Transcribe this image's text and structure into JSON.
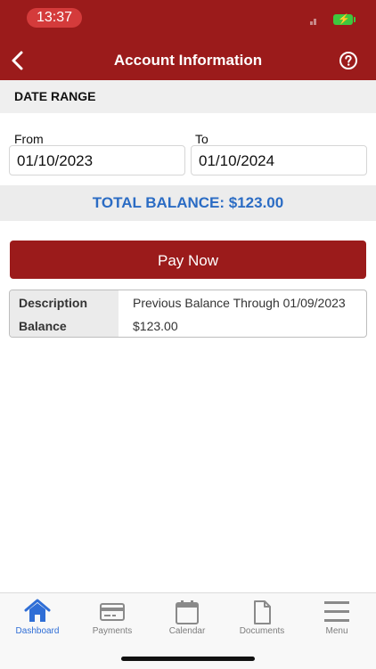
{
  "status_bar": {
    "time": "13:37"
  },
  "header": {
    "title": "Account Information",
    "back_icon": "chevron-left-icon",
    "help_icon": "question-circle-icon"
  },
  "date_range": {
    "heading": "DATE RANGE",
    "from_label": "From",
    "from_value": "01/10/2023",
    "to_label": "To",
    "to_value": "01/10/2024"
  },
  "total_balance": "TOTAL BALANCE: $123.00",
  "pay_now_label": "Pay Now",
  "details": {
    "description_label": "Description",
    "description_value": "Previous Balance Through 01/09/2023",
    "balance_label": "Balance",
    "balance_value": "$123.00"
  },
  "tabs": [
    {
      "label": "Dashboard",
      "icon": "home-icon",
      "active": true
    },
    {
      "label": "Payments",
      "icon": "credit-card-icon",
      "active": false
    },
    {
      "label": "Calendar",
      "icon": "calendar-icon",
      "active": false
    },
    {
      "label": "Documents",
      "icon": "document-icon",
      "active": false
    },
    {
      "label": "Menu",
      "icon": "hamburger-menu-icon",
      "active": false
    }
  ],
  "colors": {
    "brand": "#9b1b1b",
    "accent": "#2b6cc4",
    "tab_active": "#2f6ed6"
  }
}
